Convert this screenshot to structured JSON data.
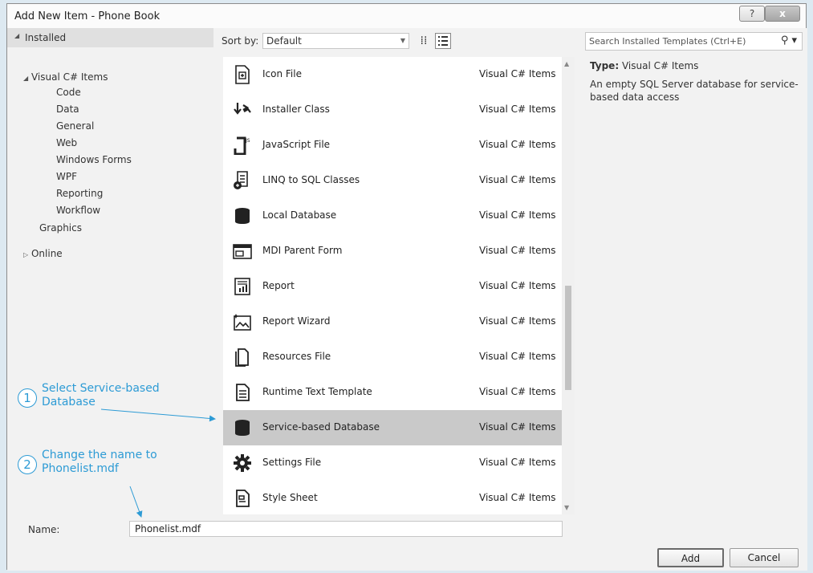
{
  "window": {
    "title": "Add New Item - Phone Book",
    "help_glyph": "?",
    "close_glyph": "x"
  },
  "left": {
    "installed": "Installed",
    "tree": [
      {
        "label": "Visual C# Items",
        "level": 1,
        "expanded": true
      },
      {
        "label": "Code",
        "level": 2
      },
      {
        "label": "Data",
        "level": 2
      },
      {
        "label": "General",
        "level": 2
      },
      {
        "label": "Web",
        "level": 2
      },
      {
        "label": "Windows Forms",
        "level": 2
      },
      {
        "label": "WPF",
        "level": 2
      },
      {
        "label": "Reporting",
        "level": 2
      },
      {
        "label": "Workflow",
        "level": 2
      },
      {
        "label": "Graphics",
        "level": 1
      }
    ],
    "online": "Online"
  },
  "sort": {
    "label": "Sort by:",
    "value": "Default"
  },
  "items": [
    {
      "name": "Icon File",
      "category": "Visual C# Items",
      "icon": "icon-file-icon"
    },
    {
      "name": "Installer Class",
      "category": "Visual C# Items",
      "icon": "installer-class-icon"
    },
    {
      "name": "JavaScript File",
      "category": "Visual C# Items",
      "icon": "javascript-file-icon"
    },
    {
      "name": "LINQ to SQL Classes",
      "category": "Visual C# Items",
      "icon": "linq-to-sql-icon"
    },
    {
      "name": "Local Database",
      "category": "Visual C# Items",
      "icon": "database-icon"
    },
    {
      "name": "MDI Parent Form",
      "category": "Visual C# Items",
      "icon": "mdi-form-icon"
    },
    {
      "name": "Report",
      "category": "Visual C# Items",
      "icon": "report-icon"
    },
    {
      "name": "Report Wizard",
      "category": "Visual C# Items",
      "icon": "report-wizard-icon"
    },
    {
      "name": "Resources File",
      "category": "Visual C# Items",
      "icon": "resources-file-icon"
    },
    {
      "name": "Runtime Text Template",
      "category": "Visual C# Items",
      "icon": "text-template-icon"
    },
    {
      "name": "Service-based Database",
      "category": "Visual C# Items",
      "icon": "database-icon",
      "selected": true
    },
    {
      "name": "Settings File",
      "category": "Visual C# Items",
      "icon": "settings-gear-icon"
    },
    {
      "name": "Style Sheet",
      "category": "Visual C# Items",
      "icon": "style-sheet-icon"
    }
  ],
  "search": {
    "placeholder": "Search Installed Templates (Ctrl+E)"
  },
  "info": {
    "type_label": "Type:",
    "type_value": "Visual C# Items",
    "description": "An empty SQL Server database for service-based data access"
  },
  "bottom": {
    "name_label": "Name:",
    "name_value": "Phonelist.mdf",
    "add_label": "Add",
    "cancel_label": "Cancel"
  },
  "callouts": [
    {
      "num": "1",
      "line1": "Select Service-based",
      "line2": "Database"
    },
    {
      "num": "2",
      "line1": "Change the name to",
      "line2": "Phonelist.mdf"
    }
  ],
  "colors": {
    "accent": "#2d9bd5",
    "selected_row": "#c9c9c9"
  }
}
